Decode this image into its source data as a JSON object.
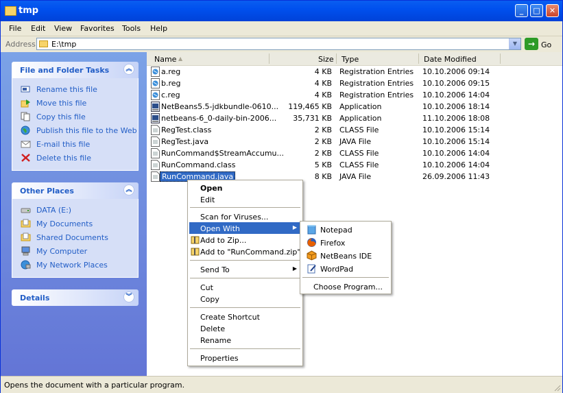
{
  "window": {
    "title": "tmp"
  },
  "menu": [
    "File",
    "Edit",
    "View",
    "Favorites",
    "Tools",
    "Help"
  ],
  "address": {
    "label": "Address",
    "value": "E:\\tmp",
    "go_label": "Go"
  },
  "tasks_panel": {
    "title": "File and Folder Tasks",
    "items": [
      {
        "label": "Rename this file",
        "icon": "rename-icon"
      },
      {
        "label": "Move this file",
        "icon": "move-icon"
      },
      {
        "label": "Copy this file",
        "icon": "copy-icon"
      },
      {
        "label": "Publish this file to the Web",
        "icon": "globe-icon"
      },
      {
        "label": "E-mail this file",
        "icon": "email-icon"
      },
      {
        "label": "Delete this file",
        "icon": "delete-icon"
      }
    ]
  },
  "places_panel": {
    "title": "Other Places",
    "items": [
      {
        "label": "DATA (E:)",
        "icon": "drive-icon"
      },
      {
        "label": "My Documents",
        "icon": "folder-icon"
      },
      {
        "label": "Shared Documents",
        "icon": "folder-icon"
      },
      {
        "label": "My Computer",
        "icon": "computer-icon"
      },
      {
        "label": "My Network Places",
        "icon": "network-icon"
      }
    ]
  },
  "details_panel": {
    "title": "Details"
  },
  "columns": {
    "name": "Name",
    "size": "Size",
    "type": "Type",
    "modified": "Date Modified"
  },
  "files": [
    {
      "name": "a.reg",
      "size": "4 KB",
      "type": "Registration Entries",
      "modified": "10.10.2006 09:14",
      "icon": "reg"
    },
    {
      "name": "b.reg",
      "size": "4 KB",
      "type": "Registration Entries",
      "modified": "10.10.2006 09:15",
      "icon": "reg"
    },
    {
      "name": "c.reg",
      "size": "4 KB",
      "type": "Registration Entries",
      "modified": "10.10.2006 14:04",
      "icon": "reg"
    },
    {
      "name": "NetBeans5.5-jdkbundle-0610...",
      "size": "119,465 KB",
      "type": "Application",
      "modified": "10.10.2006 18:14",
      "icon": "app"
    },
    {
      "name": "netbeans-6_0-daily-bin-2006...",
      "size": "35,731 KB",
      "type": "Application",
      "modified": "11.10.2006 18:08",
      "icon": "app"
    },
    {
      "name": "RegTest.class",
      "size": "2 KB",
      "type": "CLASS File",
      "modified": "10.10.2006 15:14",
      "icon": "doc"
    },
    {
      "name": "RegTest.java",
      "size": "2 KB",
      "type": "JAVA File",
      "modified": "10.10.2006 15:14",
      "icon": "doc"
    },
    {
      "name": "RunCommand$StreamAccumu...",
      "size": "2 KB",
      "type": "CLASS File",
      "modified": "10.10.2006 14:04",
      "icon": "doc"
    },
    {
      "name": "RunCommand.class",
      "size": "5 KB",
      "type": "CLASS File",
      "modified": "10.10.2006 14:04",
      "icon": "doc"
    },
    {
      "name": "RunCommand.java",
      "size": "8 KB",
      "type": "JAVA File",
      "modified": "26.09.2006 11:43",
      "icon": "doc",
      "selected": true
    }
  ],
  "context_menu": {
    "open": "Open",
    "edit": "Edit",
    "scan": "Scan for Viruses...",
    "open_with": "Open With",
    "add_zip": "Add to Zip...",
    "add_named_zip": "Add to \"RunCommand.zip\"",
    "send_to": "Send To",
    "cut": "Cut",
    "copy": "Copy",
    "create_shortcut": "Create Shortcut",
    "delete": "Delete",
    "rename": "Rename",
    "properties": "Properties"
  },
  "open_with_menu": {
    "items": [
      {
        "label": "Notepad",
        "icon": "notepad-icon"
      },
      {
        "label": "Firefox",
        "icon": "firefox-icon"
      },
      {
        "label": "NetBeans IDE",
        "icon": "netbeans-icon"
      },
      {
        "label": "WordPad",
        "icon": "wordpad-icon"
      }
    ],
    "choose": "Choose Program..."
  },
  "status": {
    "text": "Opens the document with a particular program."
  },
  "colors": {
    "title_blue": "#0050EE",
    "link_blue": "#215DC6",
    "selection": "#316AC5"
  }
}
